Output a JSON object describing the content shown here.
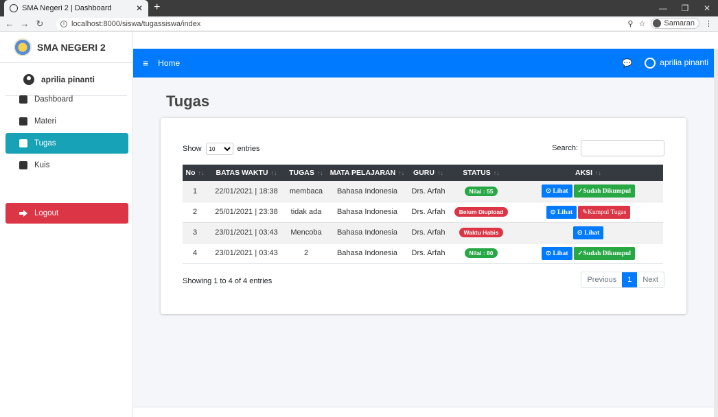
{
  "browser": {
    "tab_title": "SMA Negeri 2 | Dashboard",
    "url": "localhost:8000/siswa/tugassiswa/index",
    "profile": "Samaran"
  },
  "sidebar": {
    "brand": "SMA NEGERI 2",
    "user": "aprilia pinanti",
    "items": [
      {
        "label": "Dashboard"
      },
      {
        "label": "Materi"
      },
      {
        "label": "Tugas"
      },
      {
        "label": "Kuis"
      }
    ],
    "logout": "Logout"
  },
  "navbar": {
    "home": "Home",
    "user": "aprilia pinanti"
  },
  "page": {
    "title": "Tugas"
  },
  "table": {
    "show_label": "Show",
    "entries_value": "10",
    "entries_label": "entries",
    "search_label": "Search:",
    "headers": [
      "No",
      "BATAS WAKTU",
      "TUGAS",
      "MATA PELAJARAN",
      "GURU",
      "STATUS",
      "AKSI"
    ],
    "rows": [
      {
        "no": "1",
        "batas": "22/01/2021 | 18:38",
        "tugas": "membaca",
        "mapel": "Bahasa Indonesia",
        "guru": "Drs. Arfah",
        "status": "Nilai : 55",
        "btn1": "Lihat",
        "btn2": "Sudah Dikumpul"
      },
      {
        "no": "2",
        "batas": "25/01/2021 | 23:38",
        "tugas": "tidak ada",
        "mapel": "Bahasa Indonesia",
        "guru": "Drs. Arfah",
        "status": "Belum Diupload",
        "btn1": "Lihat",
        "btn2": "Kumpul Tugas"
      },
      {
        "no": "3",
        "batas": "23/01/2021 | 03:43",
        "tugas": "Mencoba",
        "mapel": "Bahasa Indonesia",
        "guru": "Drs. Arfah",
        "status": "Waktu Habis",
        "btn1": "Lihat"
      },
      {
        "no": "4",
        "batas": "23/01/2021 | 03:43",
        "tugas": "2",
        "mapel": "Bahasa Indonesia",
        "guru": "Drs. Arfah",
        "status": "Nilai : 80",
        "btn1": "Lihat",
        "btn2": "Sudah Dikumpul"
      }
    ],
    "showing": "Showing 1 to 4 of 4 entries",
    "pager": {
      "prev": "Previous",
      "page": "1",
      "next": "Next"
    }
  }
}
